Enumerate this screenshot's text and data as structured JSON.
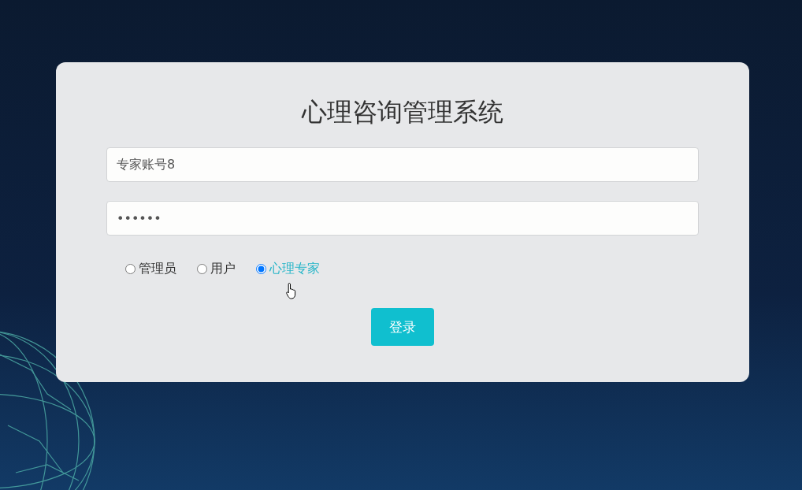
{
  "title": "心理咨询管理系统",
  "account_field": {
    "value": "专家账号8"
  },
  "password_field": {
    "value": "••••••"
  },
  "roles": [
    {
      "label": "管理员",
      "selected": false
    },
    {
      "label": "用户",
      "selected": false
    },
    {
      "label": "心理专家",
      "selected": true
    }
  ],
  "login_button": {
    "label": "登录"
  }
}
